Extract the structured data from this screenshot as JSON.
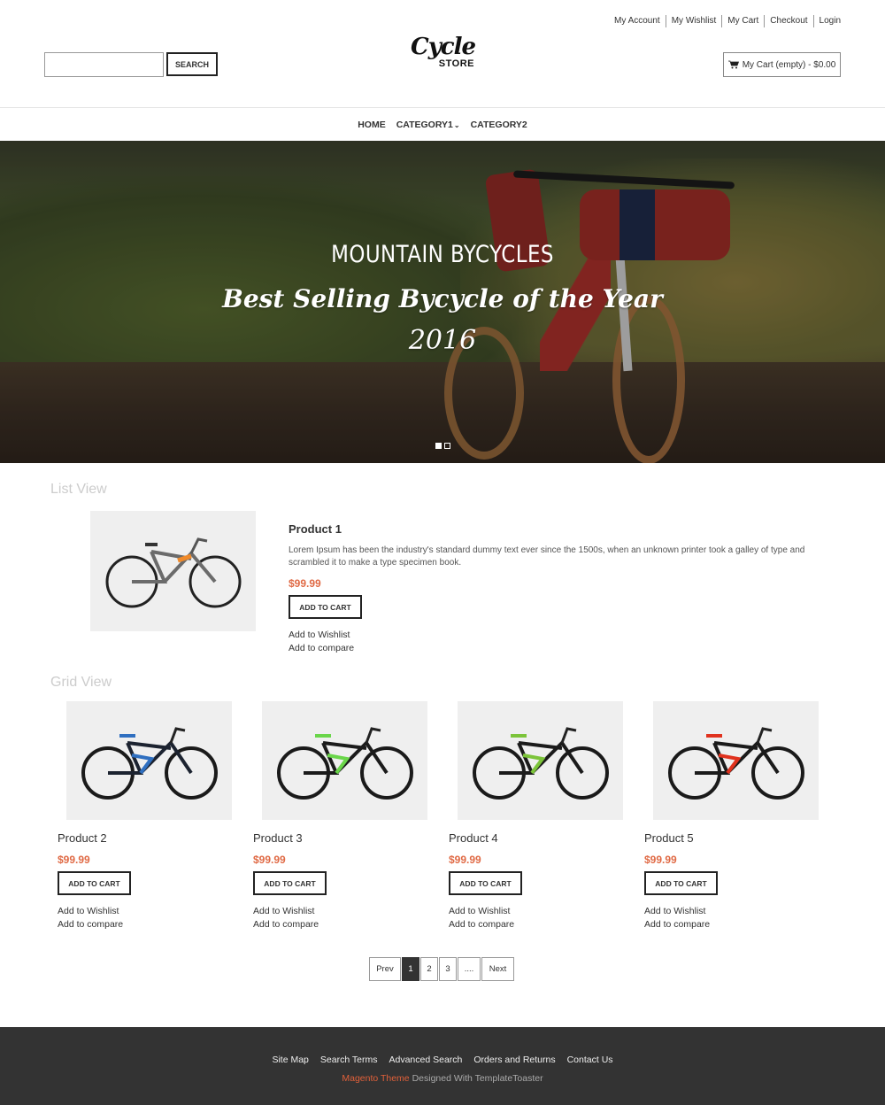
{
  "header": {
    "top_links": [
      "My Account",
      "My Wishlist",
      "My Cart",
      "Checkout",
      "Login"
    ],
    "search": {
      "placeholder": "",
      "value": "",
      "button_label": "SEARCH"
    },
    "logo": {
      "script": "Cycle",
      "sub": "STORE"
    },
    "cart": {
      "label": "My Cart (empty) - $0.00",
      "icon": "shopping-cart-icon"
    }
  },
  "nav": {
    "items": [
      {
        "label": "HOME"
      },
      {
        "label": "CATEGORY1",
        "has_dropdown": true
      },
      {
        "label": "CATEGORY2"
      }
    ]
  },
  "hero": {
    "title": "MOUNTAIN BYCYCLES",
    "subtitle": "Best Selling Bycycle of the Year",
    "year": "2016",
    "slides": 2,
    "active_slide": 1
  },
  "list_view": {
    "title": "List View",
    "product": {
      "name": "Product 1",
      "description": "Lorem Ipsum has been the industry's standard dummy text ever since the 1500s, when an unknown printer took a galley of type and scrambled it to make a type specimen book.",
      "price": "$99.99",
      "add_to_cart": "ADD TO CART",
      "wishlist": "Add to Wishlist",
      "compare": "Add to compare"
    }
  },
  "grid_view": {
    "title": "Grid View",
    "products": [
      {
        "name": "Product 2",
        "price": "$99.99",
        "add_to_cart": "ADD TO CART",
        "wishlist": "Add to Wishlist",
        "compare": "Add to compare",
        "frame_color": "#1c2330",
        "accent": "#2f6fc0"
      },
      {
        "name": "Product 3",
        "price": "$99.99",
        "add_to_cart": "ADD TO CART",
        "wishlist": "Add to Wishlist",
        "compare": "Add to compare",
        "frame_color": "#1b1b1b",
        "accent": "#6ad64a"
      },
      {
        "name": "Product 4",
        "price": "$99.99",
        "add_to_cart": "ADD TO CART",
        "wishlist": "Add to Wishlist",
        "compare": "Add to compare",
        "frame_color": "#1b1b1b",
        "accent": "#7cc43a"
      },
      {
        "name": "Product 5",
        "price": "$99.99",
        "add_to_cart": "ADD TO CART",
        "wishlist": "Add to Wishlist",
        "compare": "Add to compare",
        "frame_color": "#1b1b1b",
        "accent": "#e0321e"
      }
    ]
  },
  "pagination": {
    "prev": "Prev",
    "pages": [
      "1",
      "2",
      "3",
      "...."
    ],
    "current": "1",
    "next": "Next"
  },
  "footer": {
    "links": [
      "Site Map",
      "Search Terms",
      "Advanced Search",
      "Orders and Returns",
      "Contact Us"
    ],
    "credit_brand": "Magento Theme",
    "credit_rest": " Designed With TemplateToaster"
  },
  "colors": {
    "price": "#e06a45",
    "footer_bg": "#333333",
    "footer_brand": "#e0603a"
  }
}
